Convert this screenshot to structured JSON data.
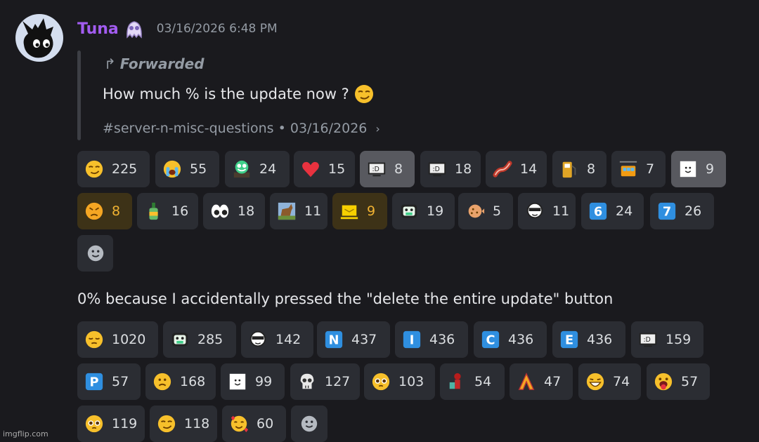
{
  "message": {
    "username": "Tuna",
    "timestamp": "03/16/2026 6:48 PM",
    "forwarded_label": "Forwarded",
    "forwarded_text": "How much % is the update now ?",
    "forwarded_source": "#server-n-misc-questions • 03/16/2026",
    "reply_text": "0% because I accidentally pressed the \"delete the entire update\" button"
  },
  "reactions1": [
    {
      "icon": "smirk-emoji-icon",
      "count": "225"
    },
    {
      "icon": "loudly-crying-emoji-icon",
      "count": "55"
    },
    {
      "icon": "custom-green-face-emoji-icon",
      "count": "24"
    },
    {
      "icon": "red-heart-emoji-icon",
      "count": "15"
    },
    {
      "icon": "custom-tv-emoji-icon",
      "count": "8"
    },
    {
      "icon": "custom-tv-emoji-icon",
      "count": "18"
    },
    {
      "icon": "bacon-emoji-icon",
      "count": "14"
    },
    {
      "icon": "fuel-pump-emoji-icon",
      "count": "8"
    },
    {
      "icon": "aerial-tramway-emoji-icon",
      "count": "7"
    },
    {
      "icon": "custom-white-ghost-emoji-icon",
      "count": "9"
    },
    {
      "icon": "angry-face-emoji-icon",
      "count": "8"
    },
    {
      "icon": "custom-green-bottle-emoji-icon",
      "count": "16"
    },
    {
      "icon": "eyes-emoji-icon",
      "count": "18"
    },
    {
      "icon": "horse-emoji-icon",
      "count": "11"
    },
    {
      "icon": "custom-yellow-box-emoji-icon",
      "count": "9"
    },
    {
      "icon": "custom-masked-face-emoji-icon",
      "count": "19"
    },
    {
      "icon": "blowfish-emoji-icon",
      "count": "5"
    },
    {
      "icon": "custom-sunglasses-face-emoji-icon",
      "count": "11"
    },
    {
      "icon": "keycap-6-emoji-icon",
      "key": "6",
      "count": "24"
    },
    {
      "icon": "keycap-7-emoji-icon",
      "key": "7",
      "count": "26"
    }
  ],
  "reactions2": [
    {
      "icon": "pensive-emoji-icon",
      "count": "1020"
    },
    {
      "icon": "custom-masked-face-emoji-icon",
      "count": "285"
    },
    {
      "icon": "custom-sunglasses-face-emoji-icon",
      "count": "142"
    },
    {
      "icon": "letter-n-emoji-icon",
      "key": "N",
      "count": "437"
    },
    {
      "icon": "letter-i-emoji-icon",
      "key": "I",
      "count": "436"
    },
    {
      "icon": "letter-c-emoji-icon",
      "key": "C",
      "count": "436"
    },
    {
      "icon": "letter-e-emoji-icon",
      "key": "E",
      "count": "436"
    },
    {
      "icon": "custom-tv-emoji-icon",
      "count": "159"
    },
    {
      "icon": "letter-p-emoji-icon",
      "key": "P",
      "count": "57"
    },
    {
      "icon": "frowning-face-emoji-icon",
      "count": "168"
    },
    {
      "icon": "custom-white-ghost-emoji-icon",
      "count": "99"
    },
    {
      "icon": "skull-emoji-icon",
      "count": "127"
    },
    {
      "icon": "pleading-face-emoji-icon",
      "count": "103"
    },
    {
      "icon": "custom-red-figure-emoji-icon",
      "count": "54"
    },
    {
      "icon": "custom-letter-a-emoji-icon",
      "count": "47"
    },
    {
      "icon": "custom-laughing-face-emoji-icon",
      "count": "74"
    },
    {
      "icon": "custom-tongue-face-emoji-icon",
      "count": "57"
    },
    {
      "icon": "pleading-face-emoji-icon",
      "count": "119"
    },
    {
      "icon": "smirk-emoji-icon",
      "count": "118"
    },
    {
      "icon": "smiling-face-with-hearts-emoji-icon",
      "count": "60"
    }
  ],
  "colors": {
    "username": "#a25cf0",
    "reaction_bg": "#2b2d33",
    "reaction_active_bg": "#58595f",
    "reaction_gold_bg": "#3d3217",
    "reaction_gold_text": "#f0b232"
  },
  "watermark": "imgflip.com"
}
